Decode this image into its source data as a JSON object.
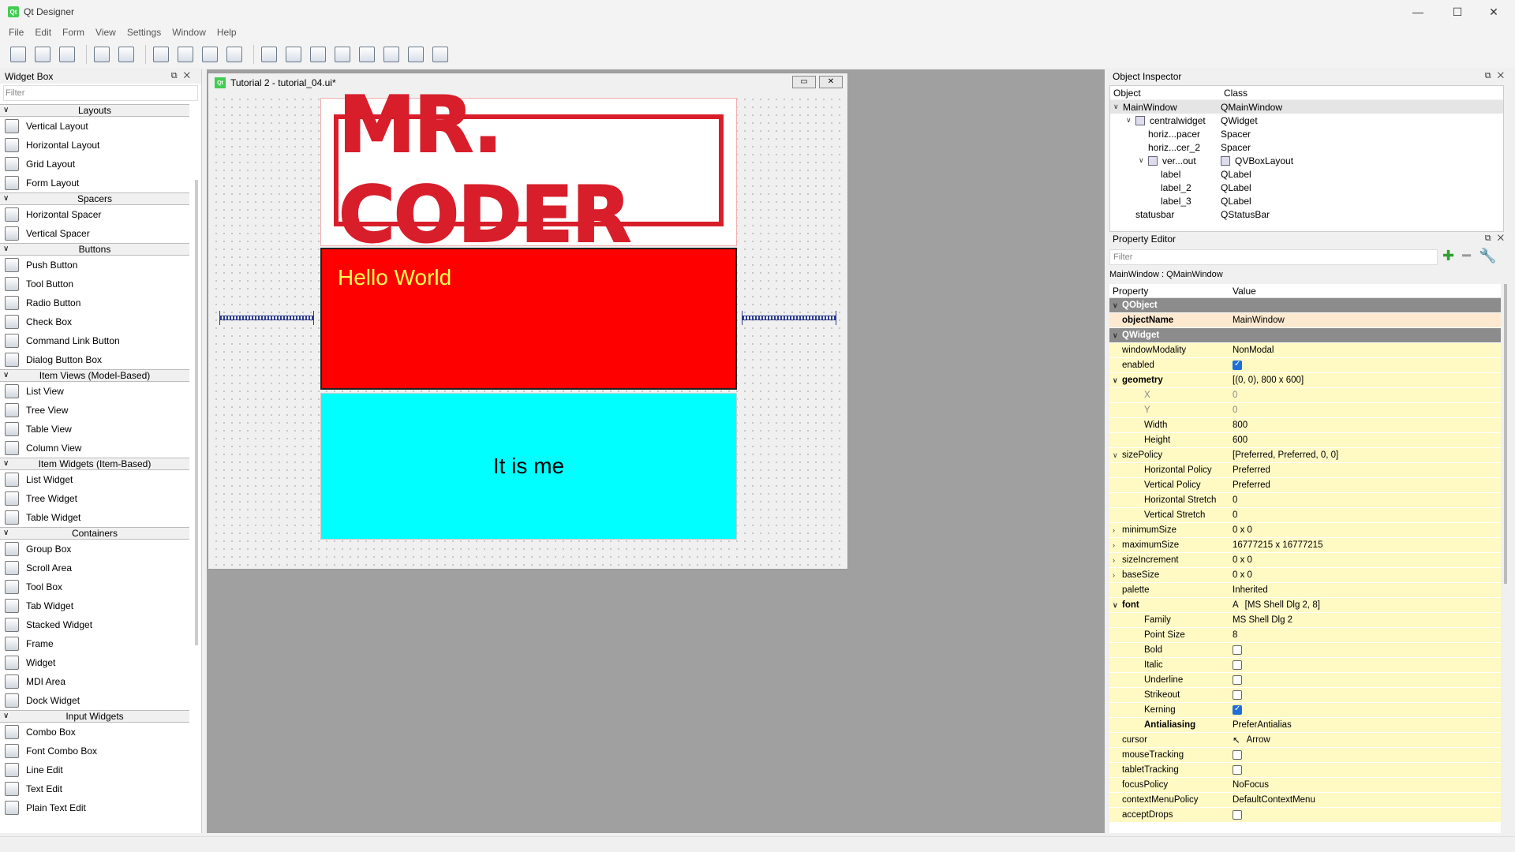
{
  "window": {
    "title": "Qt Designer",
    "app_icon": "Qt",
    "minimize": "—",
    "maximize": "☐",
    "close": "✕"
  },
  "menu": [
    "File",
    "Edit",
    "Form",
    "View",
    "Settings",
    "Window",
    "Help"
  ],
  "toolbar": {
    "group1": [
      "new-form-icon",
      "open-form-icon",
      "save-form-icon"
    ],
    "group2": [
      "send-to-back-icon",
      "bring-to-front-icon"
    ],
    "group3": [
      "edit-widgets-icon",
      "edit-signals-slots-icon",
      "edit-buddies-icon",
      "edit-tab-order-icon"
    ],
    "group4": [
      "lay-out-horizontally-icon",
      "lay-out-vertically-icon",
      "lay-out-horizontal-splitter-icon",
      "lay-out-vertical-splitter-icon",
      "lay-out-grid-icon",
      "lay-out-form-icon",
      "break-layout-icon",
      "adjust-size-icon"
    ]
  },
  "widget_box": {
    "title": "Widget Box",
    "filter_placeholder": "Filter",
    "categories": [
      {
        "label": "Layouts",
        "items": [
          "Vertical Layout",
          "Horizontal Layout",
          "Grid Layout",
          "Form Layout"
        ]
      },
      {
        "label": "Spacers",
        "items": [
          "Horizontal Spacer",
          "Vertical Spacer"
        ]
      },
      {
        "label": "Buttons",
        "items": [
          "Push Button",
          "Tool Button",
          "Radio Button",
          "Check Box",
          "Command Link Button",
          "Dialog Button Box"
        ]
      },
      {
        "label": "Item Views (Model-Based)",
        "items": [
          "List View",
          "Tree View",
          "Table View",
          "Column View"
        ]
      },
      {
        "label": "Item Widgets (Item-Based)",
        "items": [
          "List Widget",
          "Tree Widget",
          "Table Widget"
        ]
      },
      {
        "label": "Containers",
        "items": [
          "Group Box",
          "Scroll Area",
          "Tool Box",
          "Tab Widget",
          "Stacked Widget",
          "Frame",
          "Widget",
          "MDI Area",
          "Dock Widget"
        ]
      },
      {
        "label": "Input Widgets",
        "items": [
          "Combo Box",
          "Font Combo Box",
          "Line Edit",
          "Text Edit",
          "Plain Text Edit"
        ]
      }
    ]
  },
  "form": {
    "title": "Tutorial 2 - tutorial_04.ui*",
    "logo_text": "MR. CODER",
    "label2_text": "Hello World",
    "label3_text": "It is me",
    "colors": {
      "label2_bg": "#ff0000",
      "label2_fg": "#ffff55",
      "label3_bg": "#00ffff",
      "logo_red": "#d81e2a"
    }
  },
  "object_inspector": {
    "title": "Object Inspector",
    "col_object": "Object",
    "col_class": "Class",
    "rows": [
      {
        "object": "MainWindow",
        "class": "QMainWindow"
      },
      {
        "object": "centralwidget",
        "class": "QWidget"
      },
      {
        "object": "horiz...pacer",
        "class": "Spacer"
      },
      {
        "object": "horiz...cer_2",
        "class": "Spacer"
      },
      {
        "object": "ver...out",
        "class": "QVBoxLayout"
      },
      {
        "object": "label",
        "class": "QLabel"
      },
      {
        "object": "label_2",
        "class": "QLabel"
      },
      {
        "object": "label_3",
        "class": "QLabel"
      },
      {
        "object": "statusbar",
        "class": "QStatusBar"
      }
    ]
  },
  "property_editor": {
    "title": "Property Editor",
    "filter_placeholder": "Filter",
    "subtitle": "MainWindow : QMainWindow",
    "col_property": "Property",
    "col_value": "Value",
    "rows": [
      {
        "name": "QObject",
        "value": "",
        "kind": "cat"
      },
      {
        "name": "objectName",
        "value": "MainWindow",
        "kind": "o b"
      },
      {
        "name": "QWidget",
        "value": "",
        "kind": "cat"
      },
      {
        "name": "windowModality",
        "value": "NonModal",
        "kind": "y"
      },
      {
        "name": "enabled",
        "value": "",
        "kind": "y",
        "check": true
      },
      {
        "name": "geometry",
        "value": "[(0, 0), 800 x 600]",
        "kind": "y b",
        "expand": "open"
      },
      {
        "name": "X",
        "value": "0",
        "kind": "y sub",
        "indent": 2
      },
      {
        "name": "Y",
        "value": "0",
        "kind": "y sub",
        "indent": 2
      },
      {
        "name": "Width",
        "value": "800",
        "kind": "y",
        "indent": 2
      },
      {
        "name": "Height",
        "value": "600",
        "kind": "y",
        "indent": 2
      },
      {
        "name": "sizePolicy",
        "value": "[Preferred, Preferred, 0, 0]",
        "kind": "y",
        "expand": "open"
      },
      {
        "name": "Horizontal Policy",
        "value": "Preferred",
        "kind": "y",
        "indent": 2
      },
      {
        "name": "Vertical Policy",
        "value": "Preferred",
        "kind": "y",
        "indent": 2
      },
      {
        "name": "Horizontal Stretch",
        "value": "0",
        "kind": "y",
        "indent": 2
      },
      {
        "name": "Vertical Stretch",
        "value": "0",
        "kind": "y",
        "indent": 2
      },
      {
        "name": "minimumSize",
        "value": "0 x 0",
        "kind": "y",
        "expand": "closed"
      },
      {
        "name": "maximumSize",
        "value": "16777215 x 16777215",
        "kind": "y",
        "expand": "closed"
      },
      {
        "name": "sizeIncrement",
        "value": "0 x 0",
        "kind": "y",
        "expand": "closed"
      },
      {
        "name": "baseSize",
        "value": "0 x 0",
        "kind": "y",
        "expand": "closed"
      },
      {
        "name": "palette",
        "value": "Inherited",
        "kind": "y"
      },
      {
        "name": "font",
        "value": "[MS Shell Dlg 2, 8]",
        "kind": "y b",
        "expand": "open",
        "prefix": "A"
      },
      {
        "name": "Family",
        "value": "MS Shell Dlg 2",
        "kind": "y",
        "indent": 2
      },
      {
        "name": "Point Size",
        "value": "8",
        "kind": "y",
        "indent": 2
      },
      {
        "name": "Bold",
        "value": "",
        "kind": "y",
        "indent": 2,
        "check": false
      },
      {
        "name": "Italic",
        "value": "",
        "kind": "y",
        "indent": 2,
        "check": false
      },
      {
        "name": "Underline",
        "value": "",
        "kind": "y",
        "indent": 2,
        "check": false
      },
      {
        "name": "Strikeout",
        "value": "",
        "kind": "y",
        "indent": 2,
        "check": false
      },
      {
        "name": "Kerning",
        "value": "",
        "kind": "y",
        "indent": 2,
        "check": true
      },
      {
        "name": "Antialiasing",
        "value": "PreferAntialias",
        "kind": "y b",
        "indent": 2
      },
      {
        "name": "cursor",
        "value": "Arrow",
        "kind": "y",
        "prefix": "↖"
      },
      {
        "name": "mouseTracking",
        "value": "",
        "kind": "y",
        "check": false
      },
      {
        "name": "tabletTracking",
        "value": "",
        "kind": "y",
        "check": false
      },
      {
        "name": "focusPolicy",
        "value": "NoFocus",
        "kind": "y"
      },
      {
        "name": "contextMenuPolicy",
        "value": "DefaultContextMenu",
        "kind": "y"
      },
      {
        "name": "acceptDrops",
        "value": "",
        "kind": "y",
        "check": false
      }
    ]
  }
}
